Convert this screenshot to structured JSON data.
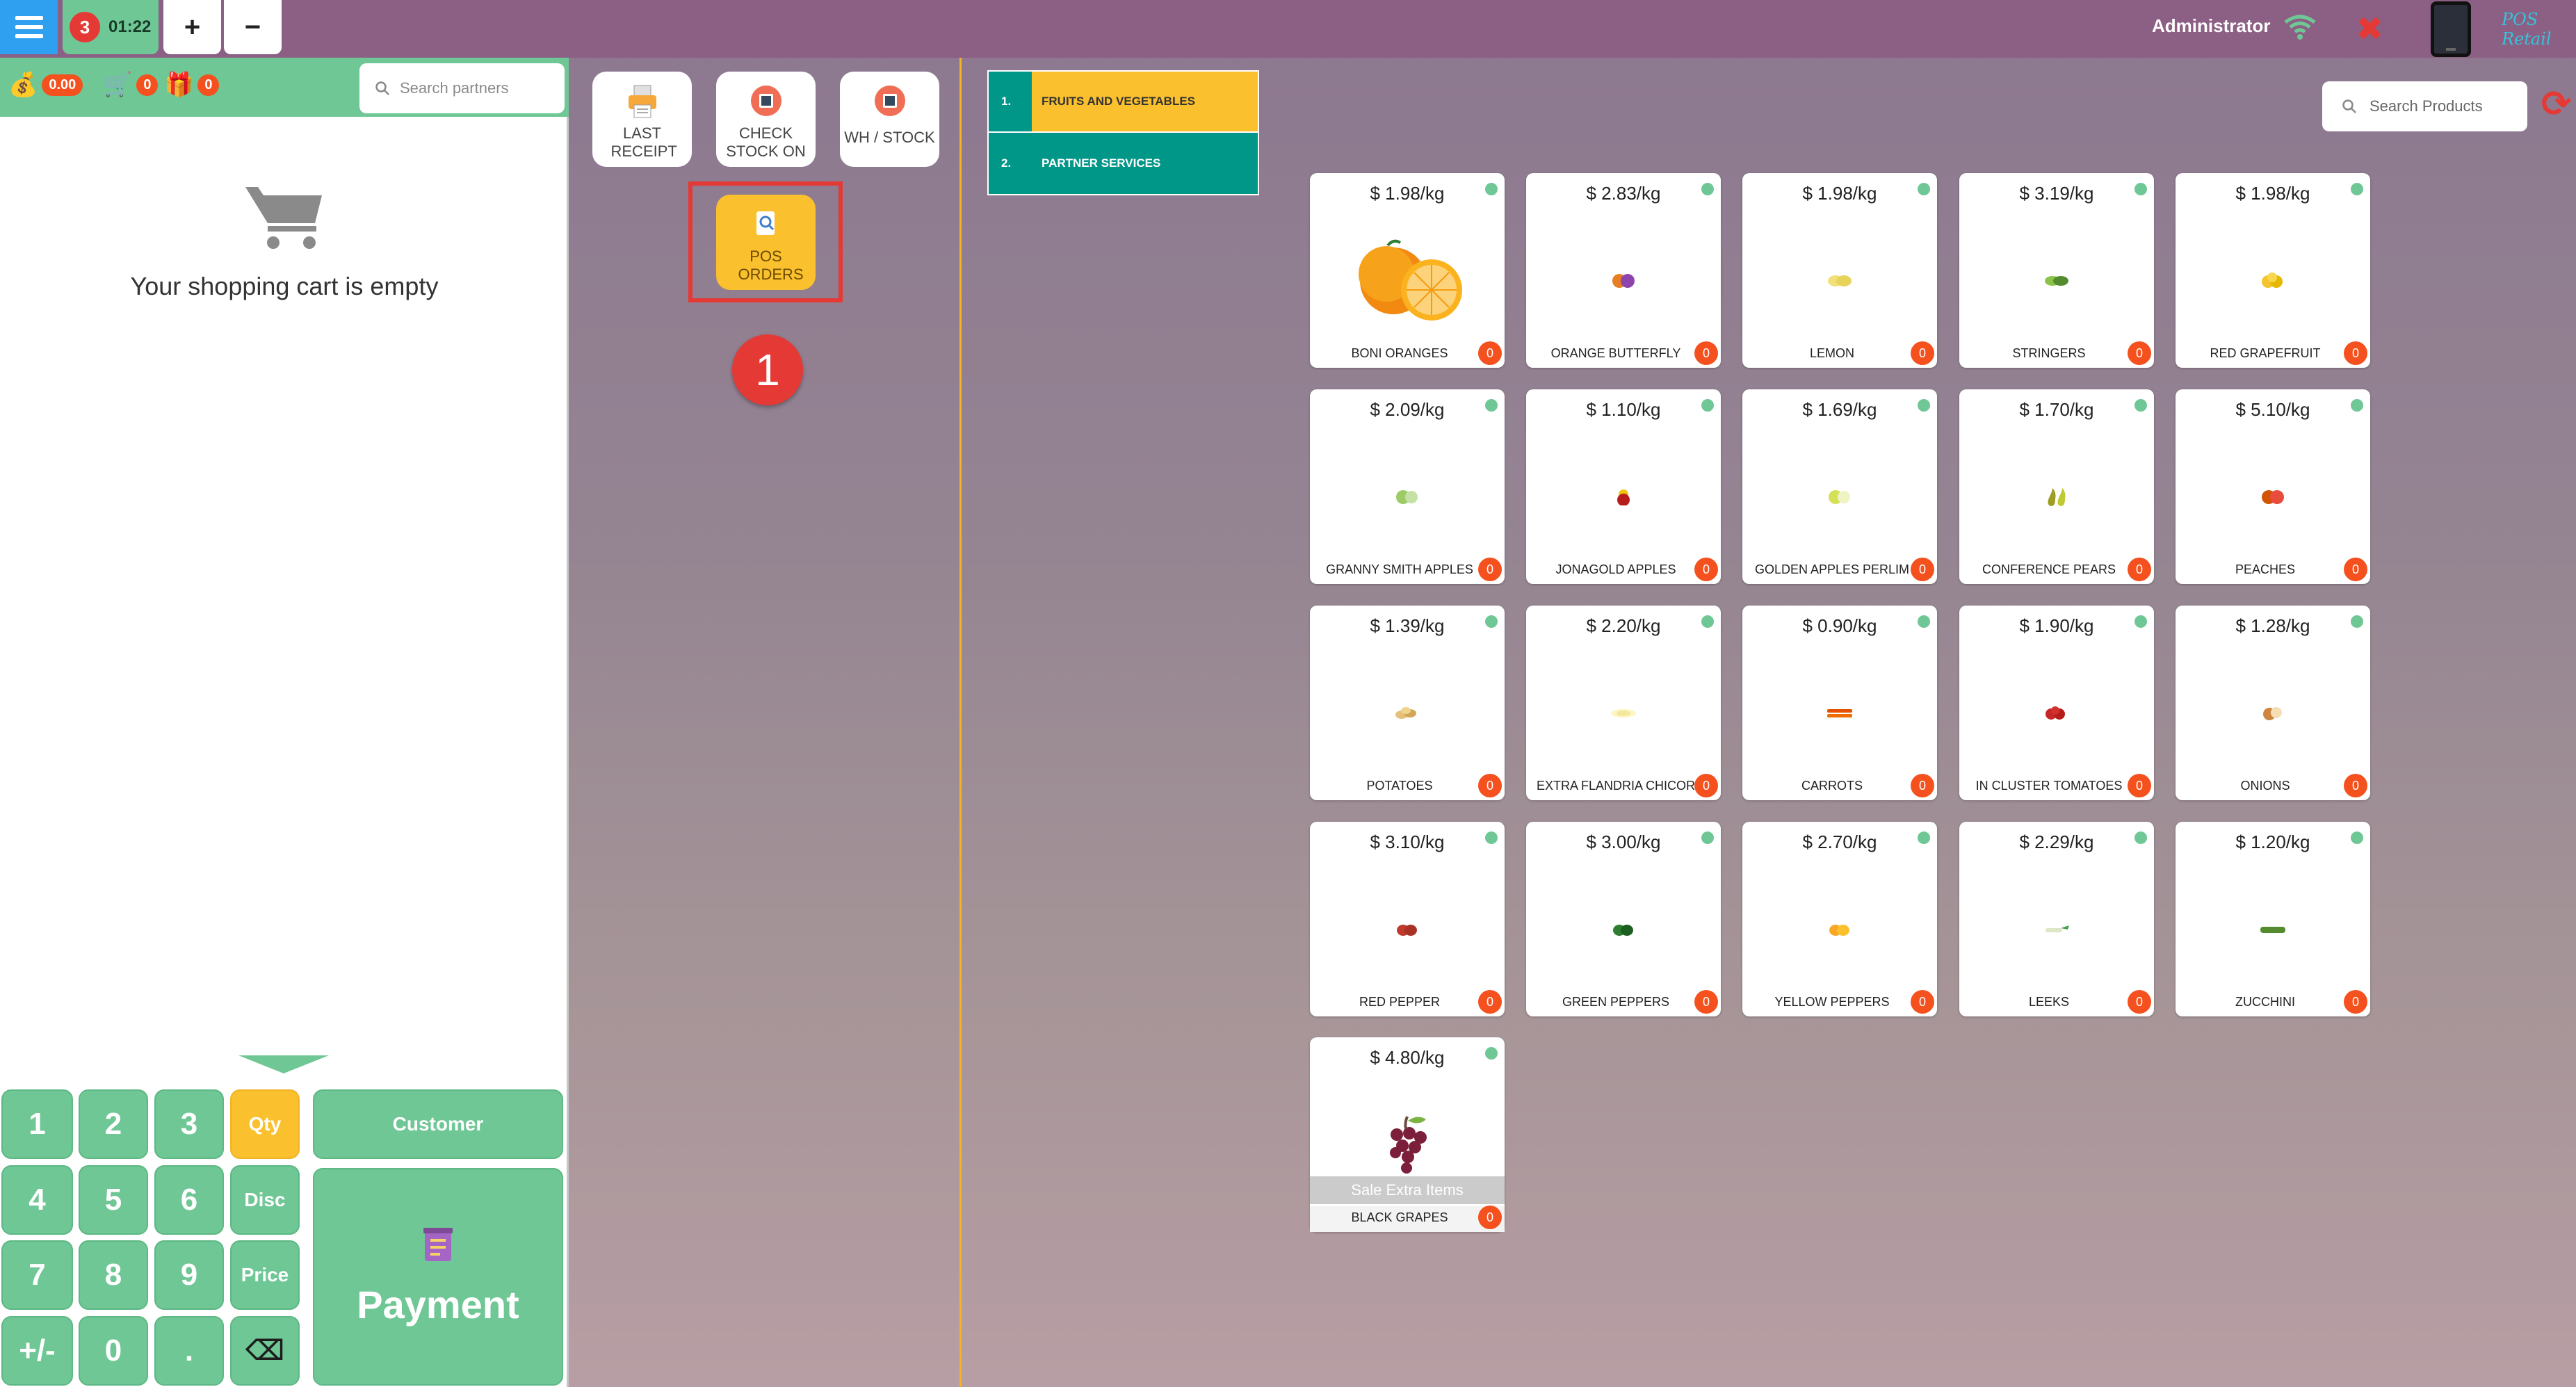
{
  "topbar": {
    "order_count": "3",
    "order_time": "01:22",
    "add_label": "+",
    "remove_label": "−",
    "user": "Administrator",
    "close_glyph": "✖",
    "brand": "POS Retail"
  },
  "left": {
    "points": "0.00",
    "cart_count": "0",
    "gift_count": "0",
    "search_placeholder": "Search partners",
    "empty_message": "Your shopping cart is empty",
    "keys": {
      "k1": "1",
      "k2": "2",
      "k3": "3",
      "qty": "Qty",
      "k4": "4",
      "k5": "5",
      "k6": "6",
      "disc": "Disc",
      "k7": "7",
      "k8": "8",
      "k9": "9",
      "price": "Price",
      "sign": "+/-",
      "k0": "0",
      "dot": ".",
      "backspace": "⌫"
    },
    "customer_label": "Customer",
    "payment_label": "Payment"
  },
  "middle": {
    "last_receipt": "LAST RECEIPT",
    "check_stock": "CHECK STOCK ON",
    "wh_stock": "WH / STOCK",
    "pos_orders": "POS ORDERS",
    "step": "1"
  },
  "categories": [
    {
      "num": "1.",
      "name": "FRUITS AND VEGETABLES"
    },
    {
      "num": "2.",
      "name": "PARTNER SERVICES"
    }
  ],
  "product_search_placeholder": "Search Products",
  "products": [
    {
      "price": "$ 1.98/kg",
      "name": "BONI ORANGES",
      "qty": "0"
    },
    {
      "price": "$ 2.83/kg",
      "name": "ORANGE BUTTERFLY",
      "qty": "0"
    },
    {
      "price": "$ 1.98/kg",
      "name": "LEMON",
      "qty": "0"
    },
    {
      "price": "$ 3.19/kg",
      "name": "STRINGERS",
      "qty": "0"
    },
    {
      "price": "$ 1.98/kg",
      "name": "RED GRAPEFRUIT",
      "qty": "0"
    },
    {
      "price": "$ 2.09/kg",
      "name": "GRANNY SMITH APPLES",
      "qty": "0"
    },
    {
      "price": "$ 1.10/kg",
      "name": "JONAGOLD APPLES",
      "qty": "0"
    },
    {
      "price": "$ 1.69/kg",
      "name": "GOLDEN APPLES PERLIM",
      "qty": "0"
    },
    {
      "price": "$ 1.70/kg",
      "name": "CONFERENCE PEARS",
      "qty": "0"
    },
    {
      "price": "$ 5.10/kg",
      "name": "PEACHES",
      "qty": "0"
    },
    {
      "price": "$ 1.39/kg",
      "name": "POTATOES",
      "qty": "0"
    },
    {
      "price": "$ 2.20/kg",
      "name": "EXTRA FLANDRIA CHICOR",
      "qty": "0"
    },
    {
      "price": "$ 0.90/kg",
      "name": "CARROTS",
      "qty": "0"
    },
    {
      "price": "$ 1.90/kg",
      "name": "IN CLUSTER TOMATOES",
      "qty": "0"
    },
    {
      "price": "$ 1.28/kg",
      "name": "ONIONS",
      "qty": "0"
    },
    {
      "price": "$ 3.10/kg",
      "name": "RED PEPPER",
      "qty": "0"
    },
    {
      "price": "$ 3.00/kg",
      "name": "GREEN PEPPERS",
      "qty": "0"
    },
    {
      "price": "$ 2.70/kg",
      "name": "YELLOW PEPPERS",
      "qty": "0"
    },
    {
      "price": "$ 2.29/kg",
      "name": "LEEKS",
      "qty": "0"
    },
    {
      "price": "$ 1.20/kg",
      "name": "ZUCCHINI",
      "qty": "0"
    },
    {
      "price": "$ 4.80/kg",
      "name": "BLACK GRAPES",
      "qty": "0",
      "extra": "Sale Extra Items"
    }
  ],
  "colors": {
    "topbar": "#8c5f84",
    "accent_green": "#6fc795",
    "accent_yellow": "#fbc02d",
    "teal": "#009688",
    "badge_orange": "#f4511e",
    "alert_red": "#e53935"
  }
}
